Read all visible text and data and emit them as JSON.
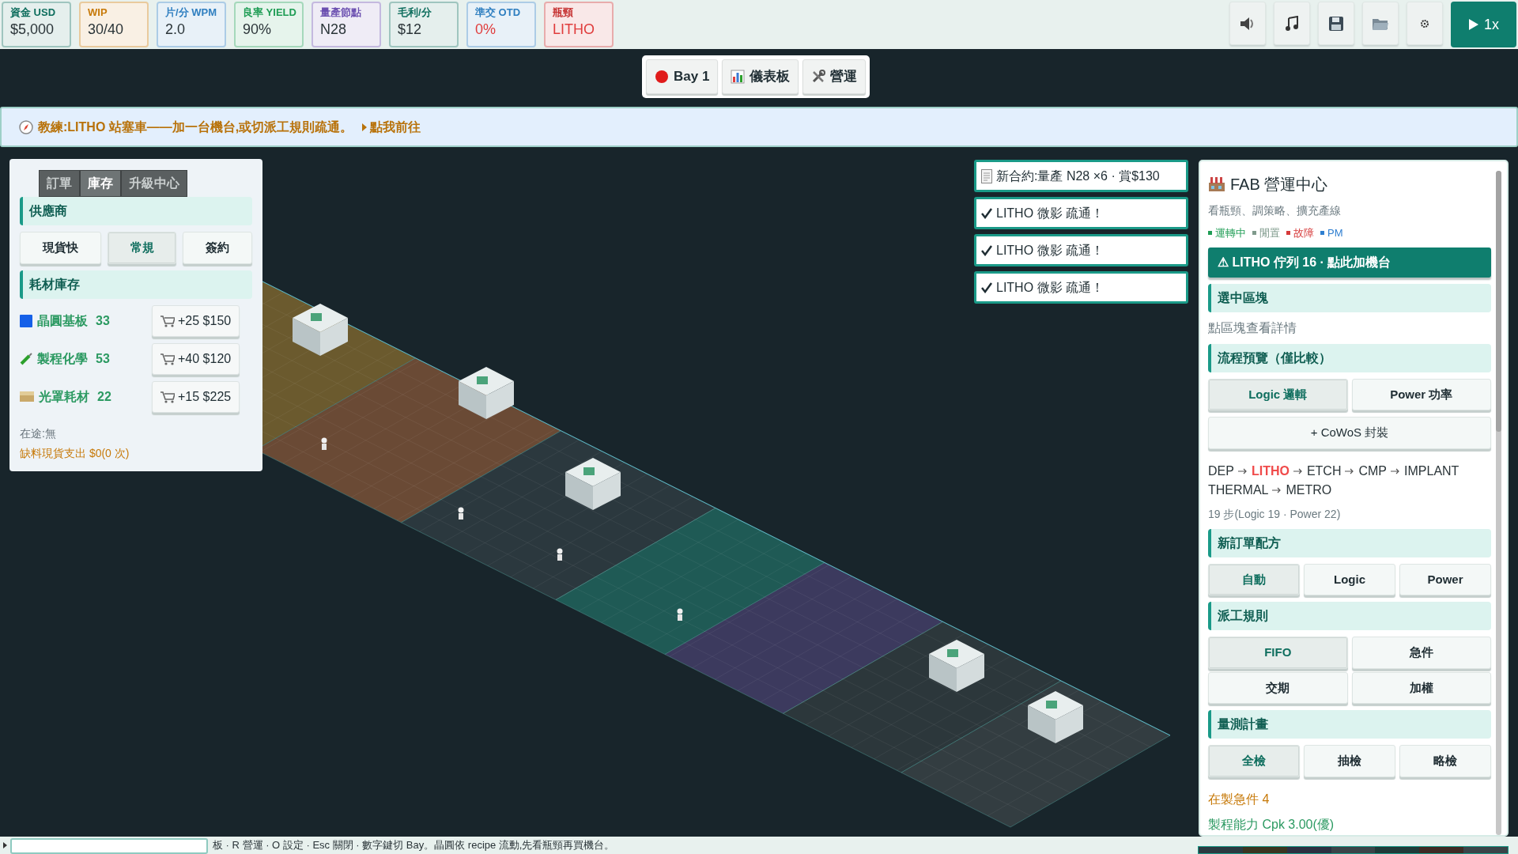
{
  "stats": [
    {
      "label": "資金 USD",
      "value": "$5,000",
      "color": "#0f6e5e",
      "alert": false
    },
    {
      "label": "WIP",
      "value": "30/40",
      "color": "#c77a0a",
      "alert": false
    },
    {
      "label": "片/分 WPM",
      "value": "2.0",
      "color": "#2f7fc0",
      "alert": false
    },
    {
      "label": "良率 YIELD",
      "value": "90%",
      "color": "#1f9d55",
      "alert": false
    },
    {
      "label": "量產節點",
      "value": "N28",
      "color": "#6b4fb0",
      "alert": false
    },
    {
      "label": "毛利/分",
      "value": "$12",
      "color": "#0f6e5e",
      "alert": false
    },
    {
      "label": "準交 OTD",
      "value": "0%",
      "color": "#2f7fc0",
      "alert": true
    },
    {
      "label": "瓶頸",
      "value": "LITHO",
      "color": "#c53030",
      "alert": true
    }
  ],
  "speed": "1x",
  "bay_tabs": [
    {
      "kind": "dot",
      "label": "Bay 1"
    },
    {
      "kind": "chart",
      "label": "儀表板"
    },
    {
      "kind": "tools",
      "label": "營運"
    }
  ],
  "coach": {
    "text": "教練:LITHO 站塞車——加一台機台,或切派工規則疏通。",
    "link": "點我前往"
  },
  "left_panel": {
    "tabs": [
      {
        "label": "訂單",
        "selected": false
      },
      {
        "label": "庫存",
        "selected": true
      },
      {
        "label": "升級中心",
        "selected": false
      }
    ],
    "supplier_heading": "供應商",
    "suppliers": [
      {
        "label": "現貨快",
        "selected": false
      },
      {
        "label": "常規",
        "selected": true
      },
      {
        "label": "簽約",
        "selected": false
      }
    ],
    "inventory_heading": "耗材庫存",
    "materials": [
      {
        "kind": "wafer",
        "name": "晶圓基板",
        "count": "33",
        "buy": "+25 $150"
      },
      {
        "kind": "chemical",
        "name": "製程化學",
        "count": "53",
        "buy": "+40 $120"
      },
      {
        "kind": "mask",
        "name": "光罩耗材",
        "count": "22",
        "buy": "+15 $225"
      }
    ],
    "in_transit": "在途:無",
    "shortage": "缺料現貨支出 $0(0 次)"
  },
  "notifications": [
    {
      "kind": "contract",
      "text": "新合約:量產 N28 ×6 · 賞$130"
    },
    {
      "kind": "resolved",
      "text": "LITHO 微影 疏通！"
    },
    {
      "kind": "resolved",
      "text": "LITHO 微影 疏通！"
    },
    {
      "kind": "resolved",
      "text": "LITHO 微影 疏通！"
    }
  ],
  "ops_panel": {
    "title": "FAB 營運中心",
    "subtitle": "看瓶頸、調策略、擴充產線",
    "legend": [
      {
        "label": "運轉中",
        "color": "#1f9d55"
      },
      {
        "label": "閒置",
        "color": "#7f9a8c"
      },
      {
        "label": "故障",
        "color": "#d63a3a"
      },
      {
        "label": "PM",
        "color": "#2f7fd0"
      }
    ],
    "alert_button": "⚠ LITHO 佇列 16 · 點此加機台",
    "selected_heading": "選中區塊",
    "selected_hint": "點區塊查看詳情",
    "flow_heading": "流程預覽（僅比較）",
    "flow_options": [
      {
        "label": "Logic 邏輯",
        "selected": true
      },
      {
        "label": "Power 功率",
        "selected": false
      }
    ],
    "add_button": "+ CoWoS 封裝",
    "steps": [
      {
        "name": "DEP",
        "bottleneck": false
      },
      {
        "name": "LITHO",
        "bottleneck": true
      },
      {
        "name": "ETCH",
        "bottleneck": false
      },
      {
        "name": "CMP",
        "bottleneck": false
      },
      {
        "name": "IMPLANT",
        "bottleneck": false
      },
      {
        "name": "THERMAL",
        "bottleneck": false
      },
      {
        "name": "METRO",
        "bottleneck": false
      }
    ],
    "steps_summary": "19 步(Logic 19 · Power 22)",
    "recipe_heading": "新訂單配方",
    "recipe_options": [
      {
        "label": "自動",
        "selected": true
      },
      {
        "label": "Logic",
        "selected": false
      },
      {
        "label": "Power",
        "selected": false
      }
    ],
    "dispatch_heading": "派工規則",
    "dispatch_options": [
      {
        "label": "FIFO",
        "selected": true
      },
      {
        "label": "急件",
        "selected": false
      },
      {
        "label": "交期",
        "selected": false
      },
      {
        "label": "加權",
        "selected": false
      }
    ],
    "metrology_heading": "量測計畫",
    "metrology_options": [
      {
        "label": "全檢",
        "selected": true
      },
      {
        "label": "抽檢",
        "selected": false
      },
      {
        "label": "略檢",
        "selected": false
      }
    ],
    "rush_wip": "在製急件 4",
    "cpk": "製程能力 Cpk 3.00(優)"
  },
  "status_bar": {
    "hint": "板 · R 營運 · O 設定 · Esc 關閉 · 數字鍵切 Bay。晶圓依 recipe 流動,先看瓶頸再買機台。"
  }
}
